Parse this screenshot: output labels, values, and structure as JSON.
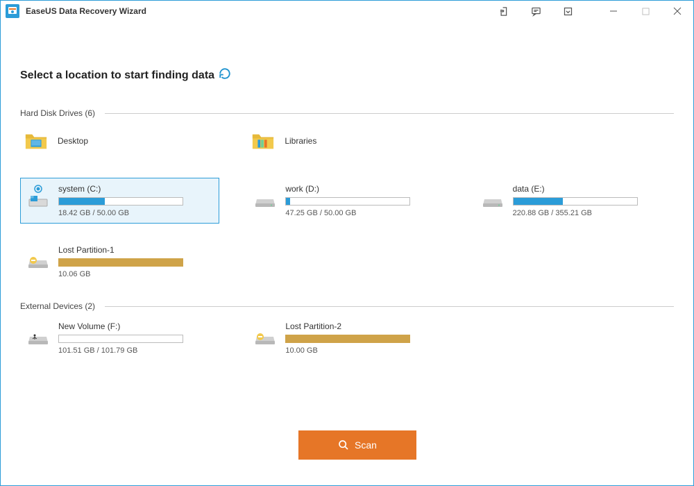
{
  "app": {
    "title": "EaseUS Data Recovery Wizard"
  },
  "headline": "Select a location to start finding data",
  "sections": {
    "hdd": {
      "title": "Hard Disk Drives (6)"
    },
    "ext": {
      "title": "External Devices (2)"
    }
  },
  "folders": {
    "desktop": "Desktop",
    "libraries": "Libraries"
  },
  "drives": {
    "c": {
      "name": "system (C:)",
      "size": "18.42 GB / 50.00 GB",
      "pct": 37,
      "color": "#2b9cd8",
      "selected": true,
      "icon": "win"
    },
    "d": {
      "name": "work (D:)",
      "size": "47.25 GB / 50.00 GB",
      "pct": 3,
      "color": "#2b9cd8",
      "icon": "hdd"
    },
    "e": {
      "name": "data (E:)",
      "size": "220.88 GB / 355.21 GB",
      "pct": 40,
      "color": "#2b9cd8",
      "icon": "hdd"
    },
    "lost1": {
      "name": "Lost Partition-1",
      "size": "10.06 GB",
      "pct": 100,
      "color": "#cfa349",
      "icon": "lost"
    },
    "f": {
      "name": "New Volume (F:)",
      "size": "101.51 GB / 101.79 GB",
      "pct": 0,
      "color": "#2b9cd8",
      "icon": "usb"
    },
    "lost2": {
      "name": "Lost Partition-2",
      "size": "10.00 GB",
      "pct": 100,
      "color": "#cfa349",
      "icon": "lost"
    }
  },
  "scan_label": "Scan",
  "colors": {
    "accent": "#2b9cd8",
    "scan": "#e67627",
    "lost": "#cfa349"
  }
}
